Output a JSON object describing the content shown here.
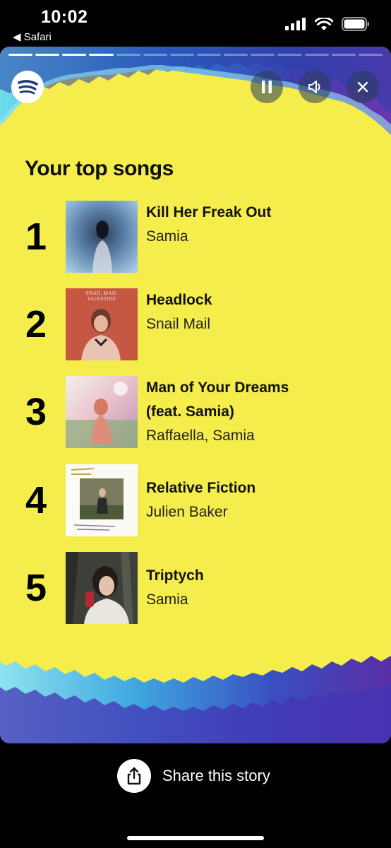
{
  "status_bar": {
    "time": "10:02",
    "back_app": "◀ Safari"
  },
  "story": {
    "progress": {
      "total": 14,
      "current": 4
    },
    "title": "Your top songs",
    "colors": {
      "background": "#F5ED4B",
      "accent_blue": "#2a7bd8",
      "accent_cyan": "#5fd4e8",
      "accent_purple": "#5a2ea6"
    },
    "songs": [
      {
        "rank": "1",
        "title": "Kill Her Freak Out",
        "artist": "Samia"
      },
      {
        "rank": "2",
        "title": "Headlock",
        "artist": "Snail Mail"
      },
      {
        "rank": "3",
        "title": "Man of Your Dreams",
        "title2": "(feat. Samia)",
        "artist": "Raffaella, Samia"
      },
      {
        "rank": "4",
        "title": "Relative Fiction",
        "artist": "Julien Baker"
      },
      {
        "rank": "5",
        "title": "Triptych",
        "artist": "Samia"
      }
    ],
    "album_2_text": {
      "line1": "SNAIL MAIL",
      "line2": "VALENTINE"
    }
  },
  "controls": {
    "pause_icon": "pause-icon",
    "sound_icon": "speaker-icon",
    "close_icon": "close-icon",
    "logo": "spotify-logo"
  },
  "share": {
    "label": "Share this story",
    "icon": "share-icon"
  }
}
